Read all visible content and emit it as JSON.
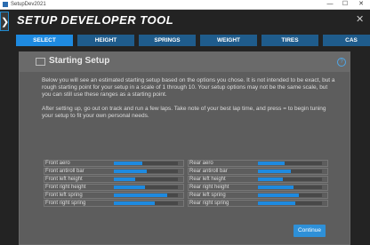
{
  "window": {
    "title": "SetupDev2021",
    "minimize": "—",
    "maximize": "☐",
    "close": "✕"
  },
  "app": {
    "title": "SETUP DEVELOPER TOOL",
    "back": "❯",
    "close": "✕"
  },
  "tabs": [
    {
      "label": "SELECT",
      "active": true
    },
    {
      "label": "HEIGHT",
      "active": false
    },
    {
      "label": "SPRINGS",
      "active": false
    },
    {
      "label": "WEIGHT",
      "active": false
    },
    {
      "label": "TIRES",
      "active": false
    },
    {
      "label": "CAS",
      "active": false
    }
  ],
  "panel": {
    "title": "Starting Setup",
    "help": "?",
    "intro_1": "Below you will see an estimated starting setup based on the options you chose. It is not intended to be exact, but a rough starting point for your setup in a scale of 1 through 10. Your setup options may not be the same scale, but you can still use these ranges as a starting point.",
    "intro_2": "After setting up, go out on track and run a few laps. Take note of your best lap time, and press = to begin tuning your setup to fit your own personal needs."
  },
  "left_settings": [
    {
      "label": "Front aero",
      "level": 0.44
    },
    {
      "label": "Front antiroll bar",
      "level": 0.52
    },
    {
      "label": "Front left height",
      "level": 0.33
    },
    {
      "label": "Front right height",
      "level": 0.49
    },
    {
      "label": "Front left spring",
      "level": 0.83
    },
    {
      "label": "Front right spring",
      "level": 0.64
    }
  ],
  "right_settings": [
    {
      "label": "Rear aero",
      "level": 0.42
    },
    {
      "label": "Rear antiroll bar",
      "level": 0.52
    },
    {
      "label": "Rear left height",
      "level": 0.39
    },
    {
      "label": "Rear right height",
      "level": 0.56
    },
    {
      "label": "Rear left spring",
      "level": 0.64
    },
    {
      "label": "Rear right spring",
      "level": 0.58
    }
  ],
  "continue_label": "Continue",
  "colors": {
    "accent": "#1e8ae0",
    "tab": "#1f5c8c",
    "panel": "#5d5d5d"
  }
}
